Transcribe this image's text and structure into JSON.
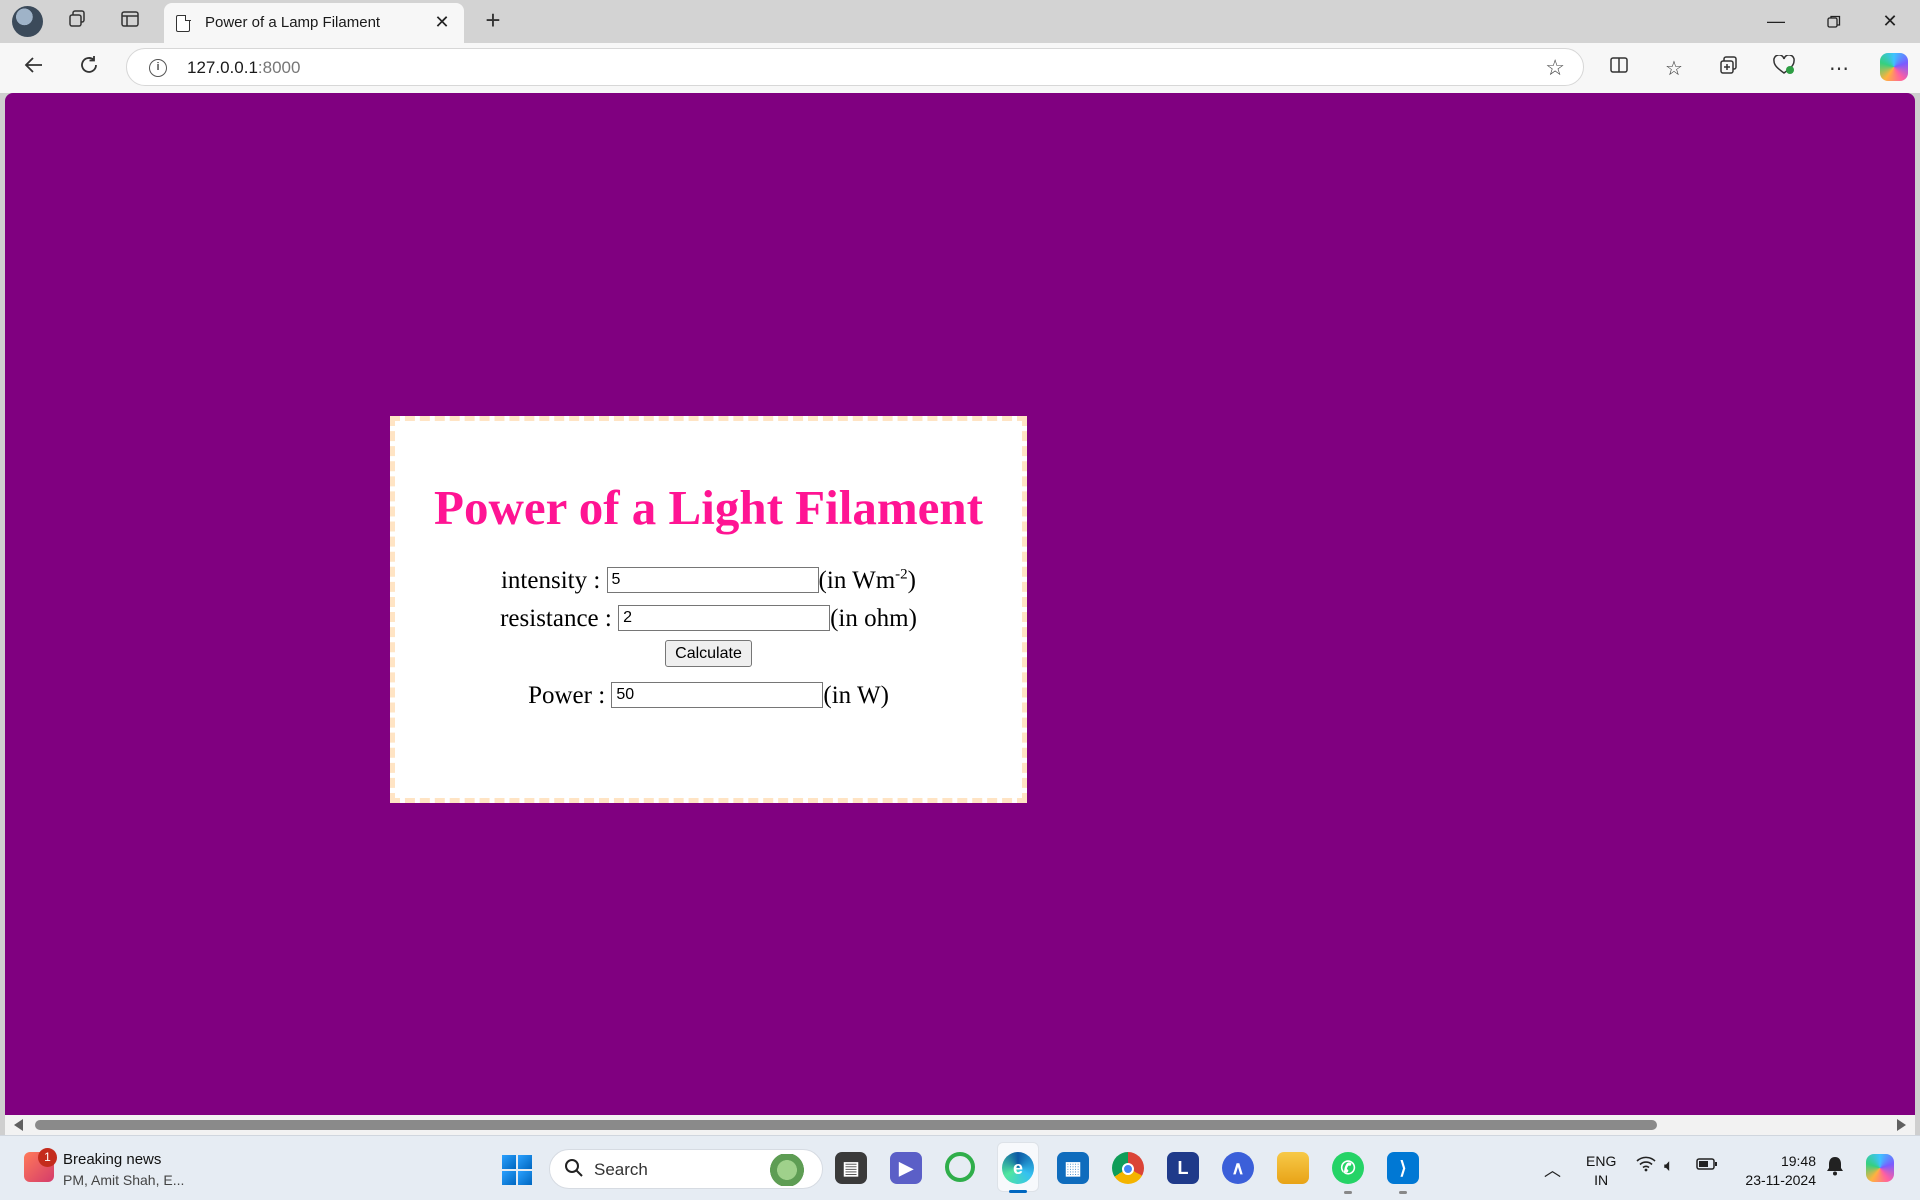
{
  "browser": {
    "tab_title": "Power of a Lamp Filament",
    "url_host": "127.0.0.1",
    "url_port": ":8000",
    "icons": [
      "profile-avatar",
      "workspaces-icon",
      "tab-actions-icon",
      "page-icon",
      "close-icon",
      "new-tab-icon",
      "minimize-icon",
      "restore-icon",
      "close-window-icon",
      "back-icon",
      "refresh-icon",
      "info-icon",
      "favorite-star-icon",
      "split-screen-icon",
      "favorites-icon",
      "collections-icon",
      "browser-essentials-icon",
      "more-icon",
      "copilot-icon"
    ]
  },
  "page": {
    "background_color": "#800080",
    "heading": "Power of a Light Filament",
    "heading_color": "#ff1493",
    "intensity": {
      "label": "intensity :",
      "value": "5",
      "unit_prefix": "(in Wm",
      "unit_sup": "-2",
      "unit_suffix": ")"
    },
    "resistance": {
      "label": "resistance :",
      "value": "2",
      "unit": "(in ohm)"
    },
    "calculate_label": "Calculate",
    "power": {
      "label": "Power :",
      "value": "50",
      "unit": "(in W)"
    }
  },
  "taskbar": {
    "news_badge": "1",
    "news_title": "Breaking news",
    "news_subtitle": "PM, Amit Shah, E...",
    "search_placeholder": "Search",
    "lang_line1": "ENG",
    "lang_line2": "IN",
    "time": "19:48",
    "date": "23-11-2024",
    "pinned_apps": [
      "file-explorer-icon",
      "teams-icon",
      "sync-icon",
      "edge-icon",
      "store-icon",
      "chrome-icon",
      "l-app-icon",
      "mountain-app-icon",
      "folder-icon",
      "whatsapp-icon",
      "vscode-icon"
    ]
  }
}
